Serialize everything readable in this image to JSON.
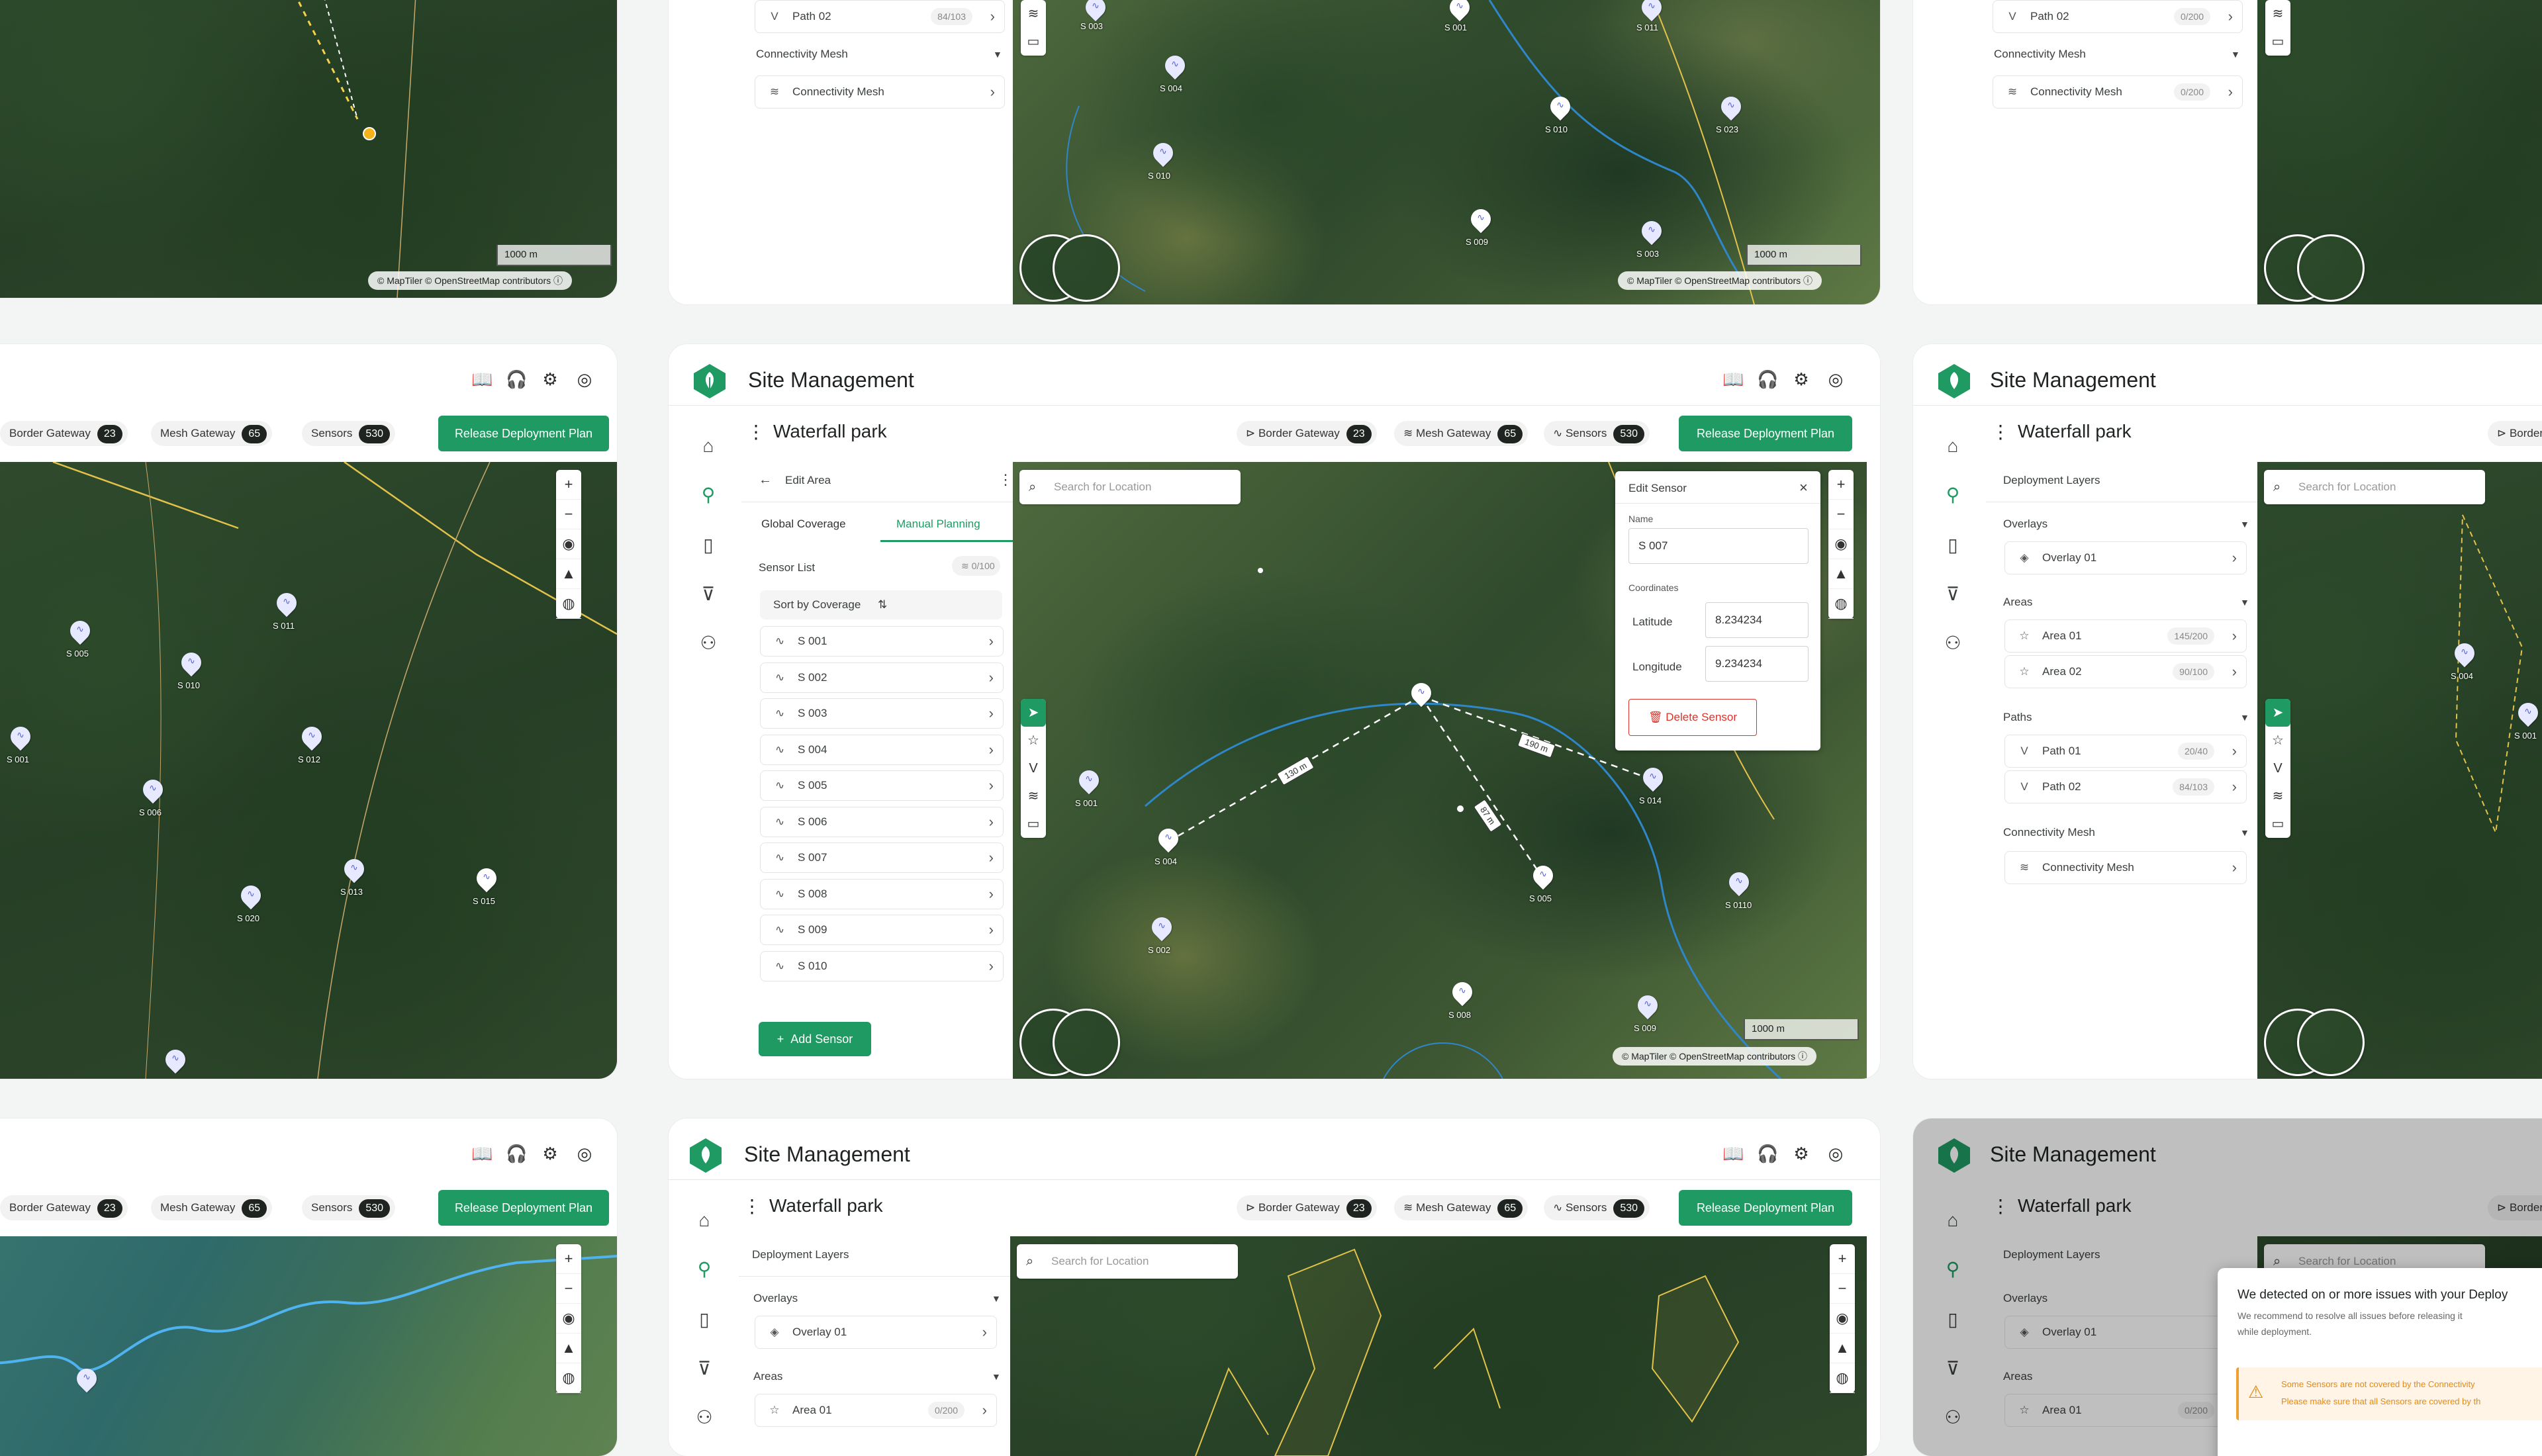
{
  "app": {
    "title": "Site Management",
    "site": "Waterfall park"
  },
  "header": {
    "icons": [
      "book-icon",
      "headset-icon",
      "gear-icon",
      "user-icon"
    ]
  },
  "chips": {
    "border_gateway": {
      "label": "Border Gateway",
      "count": "23"
    },
    "mesh_gateway": {
      "label": "Mesh Gateway",
      "count": "65"
    },
    "sensors": {
      "label": "Sensors",
      "count": "530"
    }
  },
  "release_button": "Release Deployment Plan",
  "search_placeholder": "Search for Location",
  "scale_label": "1000 m",
  "attribution": "© MapTiler © OpenStreetMap contributors",
  "layers": {
    "title": "Deployment Layers",
    "overlays_label": "Overlays",
    "overlay_item": "Overlay 01",
    "areas_label": "Areas",
    "areas": [
      {
        "name": "Area 01",
        "badge": "145/200"
      },
      {
        "name": "Area 02",
        "badge": "90/100"
      }
    ],
    "area_single": {
      "name": "Area 01",
      "badge": "0/200"
    },
    "paths_label": "Paths",
    "paths": [
      {
        "name": "Path 01",
        "badge": "20/40"
      },
      {
        "name": "Path 02",
        "badge": "84/103"
      }
    ],
    "path_top_left": {
      "name": "Path 02",
      "badge": "84/103"
    },
    "path_top_right": {
      "name": "Path 02",
      "badge": "0/200"
    },
    "mesh_label": "Connectivity Mesh",
    "mesh_item": "Connectivity Mesh"
  },
  "edit_area": {
    "title": "Edit Area",
    "tab_global": "Global Coverage",
    "tab_manual": "Manual Planning",
    "sensor_list": "Sensor List",
    "sensor_badge": "0/100",
    "sort": "Sort by Coverage",
    "sensors": [
      "S 001",
      "S 002",
      "S 003",
      "S 004",
      "S 005",
      "S 006",
      "S 007",
      "S 008",
      "S 009",
      "S 010"
    ],
    "add_sensor": "Add Sensor"
  },
  "edit_sensor": {
    "title": "Edit Sensor",
    "name_label": "Name",
    "name_value": "S 007",
    "coords_label": "Coordinates",
    "lat_label": "Latitude",
    "lat_value": "8.234234",
    "lon_label": "Longitude",
    "lon_value": "9.234234",
    "delete": "Delete Sensor"
  },
  "center_map_pins": [
    {
      "label": "S 001"
    },
    {
      "label": "S 004"
    },
    {
      "label": "S 002"
    },
    {
      "label": "S 005"
    },
    {
      "label": "S 008"
    },
    {
      "label": "S 009"
    },
    {
      "label": "S 014"
    },
    {
      "label": "S 0110"
    }
  ],
  "distances": [
    "130 m",
    "87 m",
    "190 m"
  ],
  "top_center_pins": [
    {
      "label": "S 003"
    },
    {
      "label": "S 001"
    },
    {
      "label": "S 011"
    },
    {
      "label": "S 004"
    },
    {
      "label": "S 010"
    },
    {
      "label": "S 023"
    },
    {
      "label": "S 010"
    },
    {
      "label": "S 009"
    },
    {
      "label": "S 003"
    }
  ],
  "left_map_pins": [
    {
      "label": "S 005"
    },
    {
      "label": "S 011"
    },
    {
      "label": "S 010"
    },
    {
      "label": "S 001"
    },
    {
      "label": "S 012"
    },
    {
      "label": "S 006"
    },
    {
      "label": "S 013"
    },
    {
      "label": "S 015"
    },
    {
      "label": "S 020"
    }
  ],
  "right_map_pins": [
    {
      "label": "S 004"
    },
    {
      "label": "S 001"
    }
  ],
  "modal": {
    "title": "We detected on or more issues with your Deploy",
    "body1": "We recommend to resolve all issues before releasing it",
    "body2": "while deployment.",
    "warn1": "Some Sensors are not covered by the Connectivity",
    "warn2": "Please make sure that all Sensors are covered by th"
  }
}
